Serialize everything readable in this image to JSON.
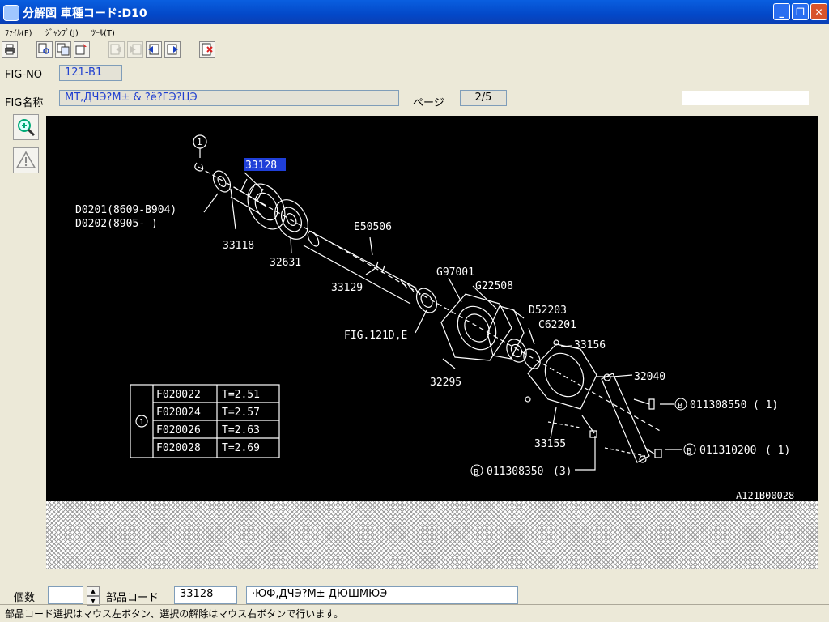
{
  "window": {
    "title": "分解図 車種コード:D10",
    "icon": "app-icon"
  },
  "menu": {
    "items": [
      "ﾌｧｲﾙ(F)",
      "ｼﾞｬﾝﾌﾟ(J)",
      "ﾂｰﾙ(T)"
    ]
  },
  "toolbar": {
    "icons": [
      "printer-icon",
      "search-icon",
      "copy-icon",
      "select-icon",
      "prev-page-icon",
      "next-page-icon",
      "back-icon",
      "forward-icon",
      "exit-icon"
    ]
  },
  "header": {
    "fig_no_label": "FIG-NO",
    "fig_no_value": "121-B1",
    "fig_name_label": "FIG名称",
    "fig_name_value": "MT,ДЧЭ?М± & ?ё?ГЭ?ЦЭ",
    "page_label": "ページ",
    "page_value": "2/5"
  },
  "diagram": {
    "selected_part": "33128",
    "callouts": [
      "33118",
      "32631",
      "E50506",
      "33129",
      "G97001",
      "G22508",
      "D52203",
      "C62201",
      "33156",
      "32040",
      "FIG.121D,E",
      "32295",
      "33155"
    ],
    "notes": [
      "D0201(8609-B904)",
      "D0202(8905-    )"
    ],
    "circle_label": "1",
    "bolts": [
      {
        "code": "011308550",
        "qty": "( 1)",
        "badge": "B"
      },
      {
        "code": "011310200",
        "qty": "( 1)",
        "badge": "B"
      },
      {
        "code": "011308350",
        "qty": "(3)",
        "badge": "B"
      }
    ],
    "table": [
      {
        "part": "F020022",
        "value": "T=2.51"
      },
      {
        "part": "F020024",
        "value": "T=2.57"
      },
      {
        "part": "F020026",
        "value": "T=2.63"
      },
      {
        "part": "F020028",
        "value": "T=2.69"
      }
    ],
    "ref_id": "A121B00028"
  },
  "footer": {
    "qty_label": "個数",
    "qty_value": "",
    "part_code_label": "部品コード",
    "part_code_value": "33128",
    "part_name_value": "·ЮФ,ДЧЭ?М± ДЮШМЮЭ"
  },
  "status": {
    "text": "部品コード選択はマウス左ボタン、選択の解除はマウス右ボタンで行います。"
  }
}
